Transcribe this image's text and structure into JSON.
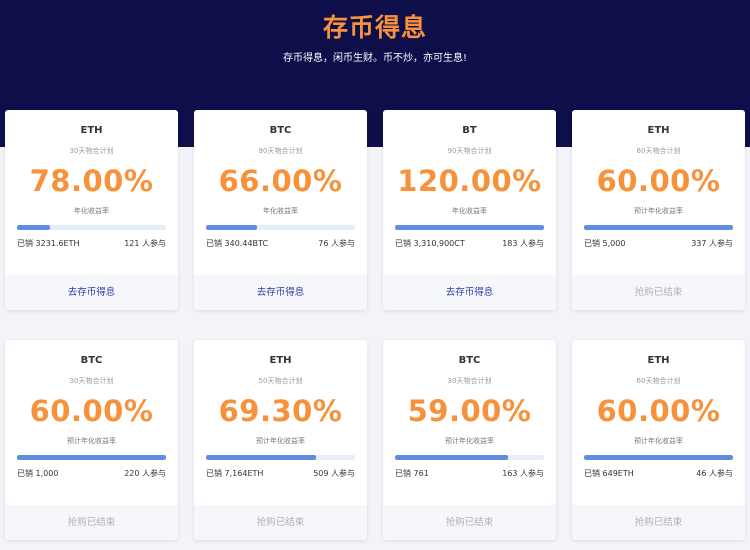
{
  "hero": {
    "title": "存币得息",
    "subtitle": "存币得息，闲币生财。币不炒，亦可生息!"
  },
  "colors": {
    "hero_bg": "#0e0f4a",
    "accent_orange": "#f7923a",
    "progress_blue": "#5f8ee0",
    "action_link": "#2d3aa6"
  },
  "cards": [
    {
      "coin": "ETH",
      "plan": "30天物合计划",
      "rate": "78.00%",
      "rate_label": "年化收益率",
      "progress": 0.22,
      "sold": "已销 3231.6ETH",
      "joined": "121 人参与",
      "action": "去存币得息",
      "status": "active"
    },
    {
      "coin": "BTC",
      "plan": "90天物合计划",
      "rate": "66.00%",
      "rate_label": "年化收益率",
      "progress": 0.34,
      "sold": "已销 340.44BTC",
      "joined": "76 人参与",
      "action": "去存币得息",
      "status": "active"
    },
    {
      "coin": "BT",
      "plan": "90天物合计划",
      "rate": "120.00%",
      "rate_label": "年化收益率",
      "progress": 1.0,
      "sold": "已销 3,310,900CT",
      "joined": "183 人参与",
      "action": "去存币得息",
      "status": "active"
    },
    {
      "coin": "ETH",
      "plan": "60天物合计划",
      "rate": "60.00%",
      "rate_label": "预计年化收益率",
      "progress": 1.0,
      "sold": "已销 5,000",
      "joined": "337 人参与",
      "action": "抢购已结束",
      "status": "ended"
    },
    {
      "coin": "BTC",
      "plan": "30天物合计划",
      "rate": "60.00%",
      "rate_label": "预计年化收益率",
      "progress": 1.0,
      "sold": "已销 1,000",
      "joined": "220 人参与",
      "action": "抢购已结束",
      "status": "ended"
    },
    {
      "coin": "ETH",
      "plan": "50天物合计划",
      "rate": "69.30%",
      "rate_label": "预计年化收益率",
      "progress": 0.74,
      "sold": "已销 7,164ETH",
      "joined": "509 人参与",
      "action": "抢购已结束",
      "status": "ended"
    },
    {
      "coin": "BTC",
      "plan": "30天物合计划",
      "rate": "59.00%",
      "rate_label": "预计年化收益率",
      "progress": 0.76,
      "sold": "已销 761",
      "joined": "163 人参与",
      "action": "抢购已结束",
      "status": "ended"
    },
    {
      "coin": "ETH",
      "plan": "60天物合计划",
      "rate": "60.00%",
      "rate_label": "预计年化收益率",
      "progress": 1.0,
      "sold": "已销 649ETH",
      "joined": "46 人参与",
      "action": "抢购已结束",
      "status": "ended"
    }
  ]
}
